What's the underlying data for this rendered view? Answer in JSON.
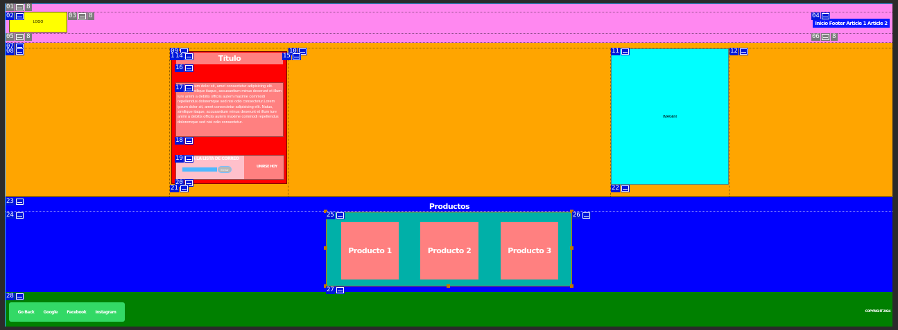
{
  "colors": {
    "header": "#ff88f0",
    "main": "#ffa500",
    "products": "#0000ff",
    "footer": "#008000",
    "logo": "#ffff00",
    "card": "#ff0000",
    "image": "#00ffff",
    "product_card": "#ff8080",
    "product_container": "#00b0a8"
  },
  "header": {
    "logo_text": "LOGO",
    "nav_text": "Inicio Footer Article 1 Article 2"
  },
  "card": {
    "title": "Título",
    "body": "Lorem ipsum dolor sit, amet consectetur adipisicing elit. Natus, similique itaque, accusantium minus deserunt et illum iure animi a debitis officiis autem maxime commodi repellendus doloremque sed nisi odio consectetur.Lorem ipsum dolor sit, amet consectetur adipisicing elit. Natus, similique itaque, accusantium minus deserunt et illum iure animi a debitis officiis autem maxime commodi repellendus doloremque sed nisi odio consectetur.",
    "newsletter_label": "ÚNETE A LA LISTA DE CORREO",
    "send_button": "Enviar",
    "join_label": "UNIRSE HOY"
  },
  "image_box": {
    "label": "IMAGEN"
  },
  "products": {
    "title": "Productos",
    "items": [
      "Producto 1",
      "Producto 2",
      "Producto 3"
    ]
  },
  "footer": {
    "links": [
      "Go Back",
      "Google",
      "Facebook",
      "Instagram"
    ],
    "copyright": "COPYRIGHT 2024"
  },
  "guides": [
    "01",
    "02",
    "03",
    "04",
    "05",
    "06",
    "07",
    "08",
    "09",
    "10",
    "11",
    "12",
    "13",
    "14",
    "15",
    "16",
    "17",
    "18",
    "19",
    "20",
    "21",
    "22",
    "23",
    "24",
    "25",
    "26",
    "27",
    "28"
  ],
  "guide_suffix": "8"
}
